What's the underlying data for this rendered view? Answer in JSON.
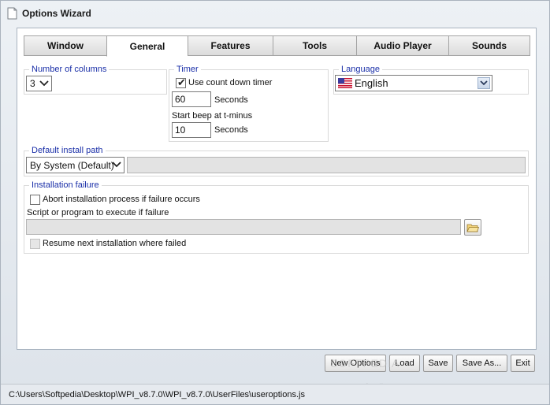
{
  "window": {
    "title": "Options Wizard"
  },
  "tabs": [
    {
      "label": "Window",
      "active": false
    },
    {
      "label": "General",
      "active": true
    },
    {
      "label": "Features",
      "active": false
    },
    {
      "label": "Tools",
      "active": false
    },
    {
      "label": "Audio Player",
      "active": false
    },
    {
      "label": "Sounds",
      "active": false
    }
  ],
  "columns": {
    "legend": "Number of columns",
    "value": "3"
  },
  "timer": {
    "legend": "Timer",
    "use_countdown_label": "Use count down timer",
    "use_countdown_checked": true,
    "seconds_value": "60",
    "seconds_label": "Seconds",
    "beep_label": "Start beep at t-minus",
    "beep_value": "10",
    "beep_seconds_label": "Seconds"
  },
  "language": {
    "legend": "Language",
    "value": "English",
    "flag_icon": "us-flag-icon"
  },
  "install_path": {
    "legend": "Default install path",
    "mode": "By System (Default)",
    "path_value": ""
  },
  "failure": {
    "legend": "Installation failure",
    "abort_label": "Abort installation process if failure occurs",
    "abort_checked": false,
    "script_label": "Script or program to execute if failure",
    "script_value": "",
    "resume_label": "Resume next installation where failed",
    "resume_checked": false
  },
  "buttons": {
    "new_options": "New Options",
    "load": "Load",
    "save": "Save",
    "save_as": "Save As...",
    "exit": "Exit"
  },
  "status": {
    "path": "C:\\Users\\Softpedia\\Desktop\\WPI_v8.7.0\\WPI_v8.7.0\\UserFiles\\useroptions.js"
  },
  "watermark": {
    "main": "SOFTPEDIA",
    "sub": "www.softpedia.com"
  },
  "colors": {
    "legend": "#1a2fa8",
    "window_bg": "#dfe5ec"
  }
}
